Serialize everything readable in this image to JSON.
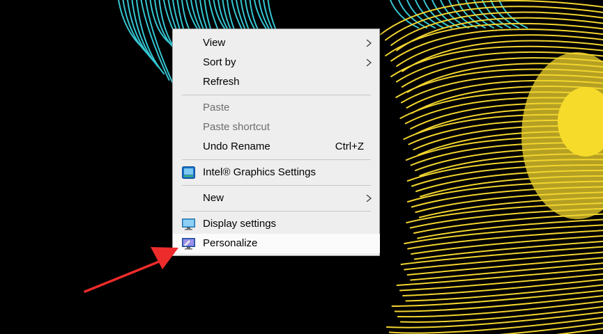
{
  "colors": {
    "menu_background": "#eeeeee",
    "menu_highlight": "#fbfbfb",
    "feather_cyan": "#36c6d3",
    "feather_yellow": "#f2d52f",
    "annotation_arrow": "#ee2b2b"
  },
  "context_menu": {
    "view_label": "View",
    "sort_by_label": "Sort by",
    "refresh_label": "Refresh",
    "paste_label": "Paste",
    "paste_shortcut_label": "Paste shortcut",
    "undo_rename_label": "Undo Rename",
    "undo_rename_shortcut": "Ctrl+Z",
    "intel_graphics_label": "Intel® Graphics Settings",
    "new_label": "New",
    "display_settings_label": "Display settings",
    "personalize_label": "Personalize"
  },
  "icons": {
    "submenu": "chevron-right-icon",
    "intel": "intel-graphics-icon",
    "display": "monitor-icon",
    "personalize": "personalize-icon",
    "annotation": "red-arrow-icon"
  }
}
